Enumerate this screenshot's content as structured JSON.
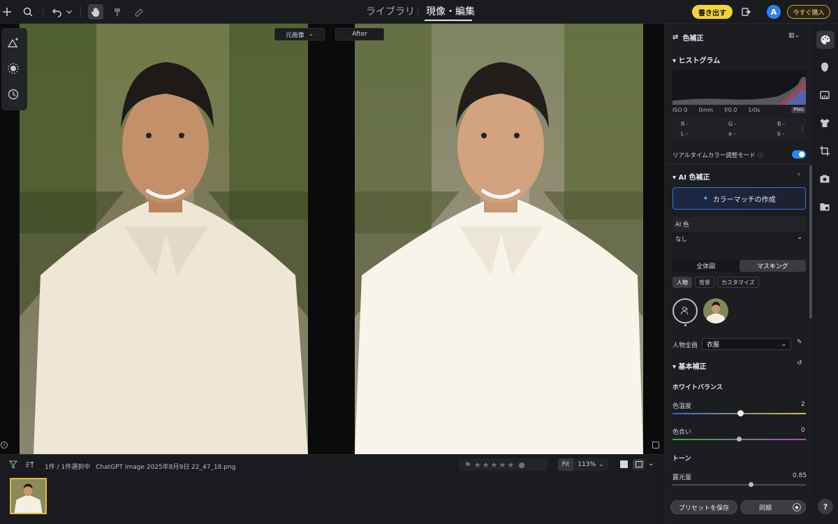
{
  "topbar": {
    "tab_library": "ライブラリ",
    "tab_develop": "現像・編集",
    "export_label": "書き出す",
    "avatar_letter": "A",
    "buy_label": "今すぐ購入"
  },
  "canvas": {
    "before_selector": "元画像",
    "after_label": "After",
    "info_glyph": "i"
  },
  "filmstrip": {
    "selection_text": "1件 / 1件選択中",
    "filename": "ChatGPT Image 2025年8月9日 22_47_18.png",
    "rating_stars": "★★★★★",
    "fit_label": "Fit",
    "zoom_level": "113%"
  },
  "panel": {
    "title": "色補正",
    "histogram_title": "ヒストグラム",
    "exif": {
      "iso": "ISO 0",
      "focal": "0mm",
      "aperture": "f/0.0",
      "shutter": "1/0s",
      "format": "PNG"
    },
    "rgb": {
      "r": "R -",
      "g": "G -",
      "b": "B -",
      "l": "L -",
      "a": "a -",
      "b2": "b -"
    },
    "realtime_label": "リアルタイムカラー調整モード",
    "realtime_on": true,
    "ai_title": "AI 色補正",
    "match_button": "カラーマッチの作成",
    "ai_color_label": "AI 色",
    "ai_color_value": "なし",
    "seg_all": "全体図",
    "seg_masking": "マスキング",
    "chip_person": "人物",
    "chip_background": "背景",
    "chip_custom": "カスタマイズ",
    "person_all_label": "人物全員",
    "person_all_value": "衣服",
    "basic_title": "基本補正",
    "wb_title": "ホワイトバランス",
    "temp_label": "色温度",
    "temp_value": "2",
    "temp_level": 0.51,
    "tint_label": "色合い",
    "tint_value": "0",
    "tint_level": 0.5,
    "tone_title": "トーン",
    "exposure_label": "露光量",
    "exposure_value": "0.85",
    "exposure_level": 0.59,
    "save_preset": "プリセットを保存",
    "sync": "同期"
  },
  "help_glyph": "?",
  "colors": {
    "accent_blue": "#2f84f0",
    "export_yellow": "#f2d43b",
    "thumb_border": "#e2b93b"
  }
}
